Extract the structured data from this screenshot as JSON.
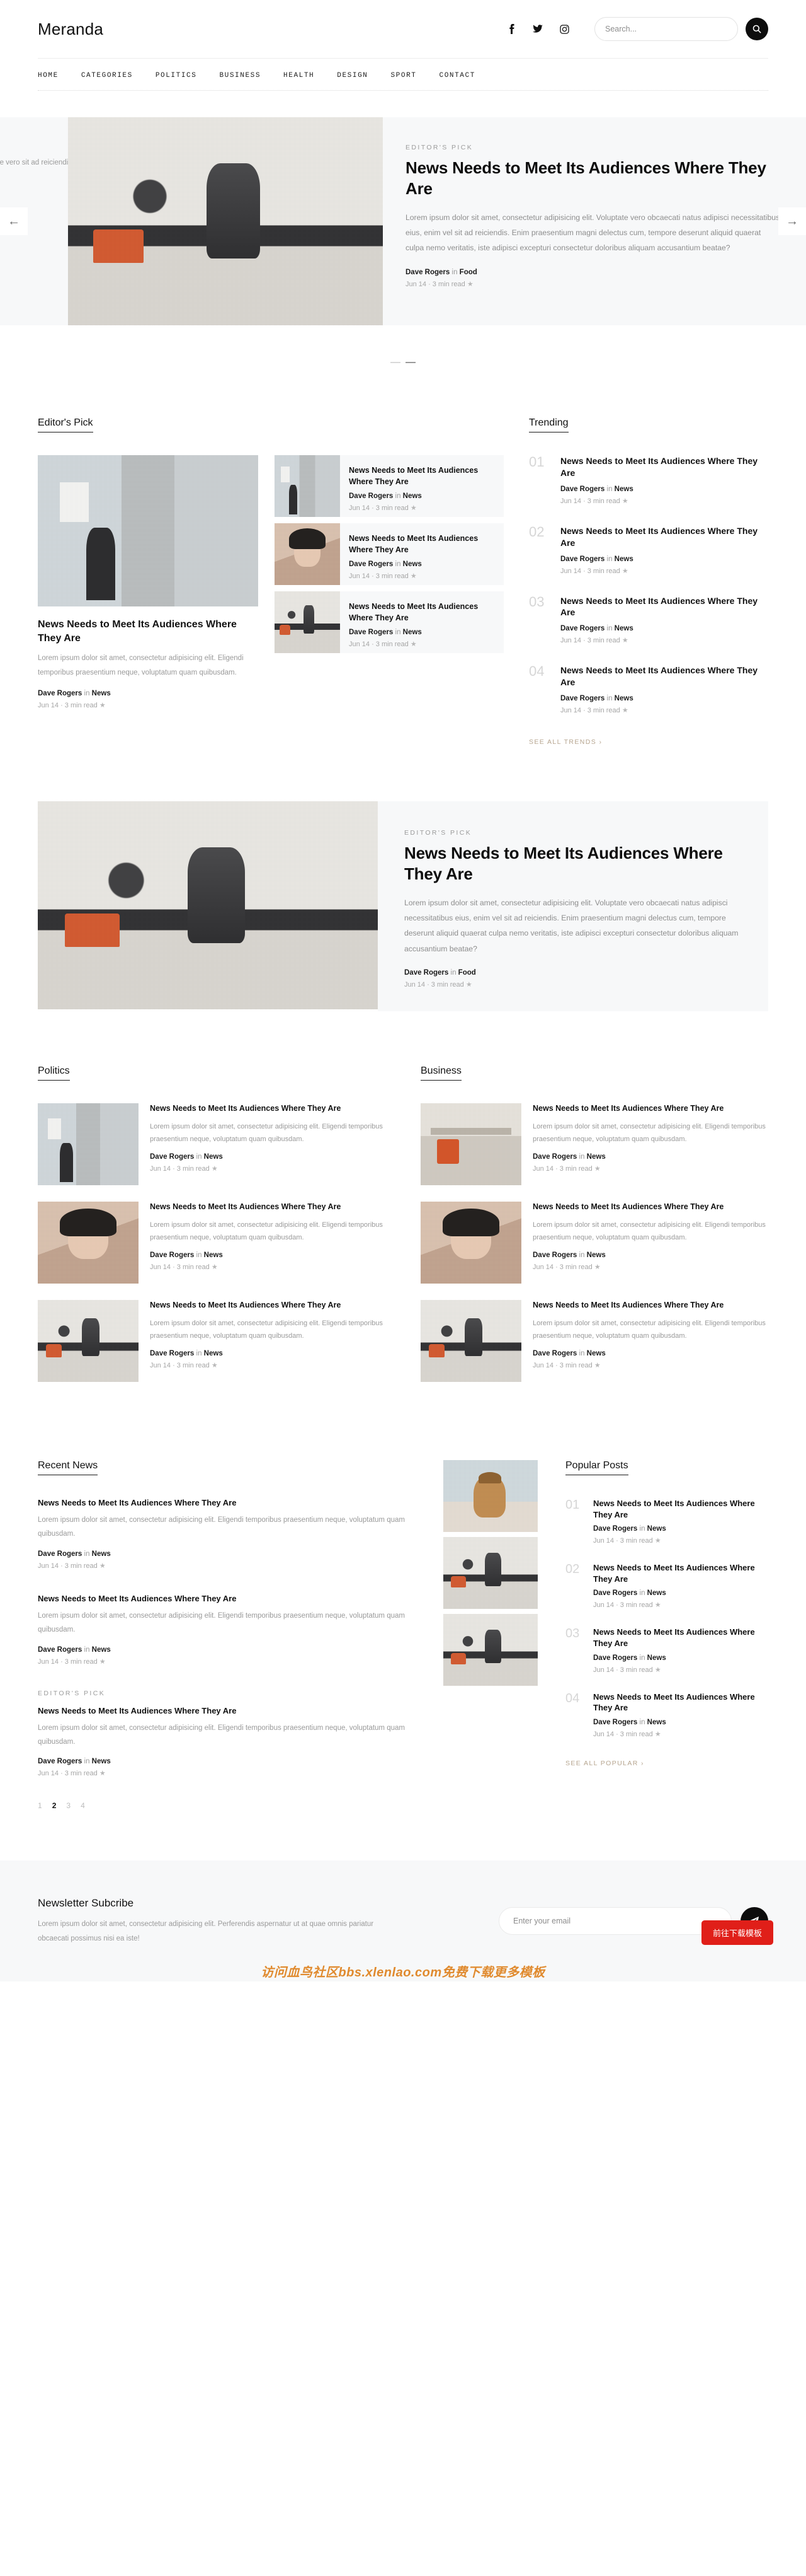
{
  "site": {
    "brand": "Meranda"
  },
  "header": {
    "social": [
      {
        "name": "facebook-icon",
        "label": "f"
      },
      {
        "name": "twitter-icon",
        "label": "t"
      },
      {
        "name": "instagram-icon",
        "label": "i"
      }
    ],
    "search": {
      "placeholder": "Search...",
      "value": "",
      "button_icon": "search-icon"
    }
  },
  "nav": {
    "items": [
      "HOME",
      "CATEGORIES",
      "POLITICS",
      "BUSINESS",
      "HEALTH",
      "DESIGN",
      "SPORT",
      "CONTACT"
    ]
  },
  "hero": {
    "eyebrow": "EDITOR'S PICK",
    "title": "News Needs to Meet Its Audiences Where They Are",
    "desc": "Lorem ipsum dolor sit amet, consectetur adipisicing elit. Voluptate vero obcaecati natus adipisci necessitatibus eius, enim vel sit ad reiciendis. Enim praesentium magni delectus cum, tempore deserunt aliquid quaerat culpa nemo veritatis, iste adipisci excepturi consectetur doloribus aliquam accusantium beatae?",
    "author": "Dave Rogers",
    "in": "in",
    "category": "Food",
    "meta": "Jun 14  ·  3 min read",
    "ghost_text": "Voluptate vero\nsit ad reiciendis enim\nquaerat culpa\naliquam",
    "prev_icon": "arrow-left-icon",
    "next_icon": "arrow-right-icon",
    "dots": [
      {
        "active": false
      },
      {
        "active": true
      }
    ]
  },
  "editors_pick": {
    "heading": "Editor's Pick",
    "feature": {
      "title": "News Needs to Meet Its Audiences Where They Are",
      "excerpt": "Lorem ipsum dolor sit amet, consectetur adipisicing elit. Eligendi temporibus praesentium neque, voluptatum quam quibusdam.",
      "author": "Dave Rogers",
      "in": "in",
      "category": "News",
      "meta": "Jun 14  ·  3 min read"
    },
    "list": [
      {
        "title": "News Needs to Meet Its Audiences Where They Are",
        "author": "Dave Rogers",
        "in": "in",
        "category": "News",
        "meta": "Jun 14  ·  3 min read"
      },
      {
        "title": "News Needs to Meet Its Audiences Where They Are",
        "author": "Dave Rogers",
        "in": "in",
        "category": "News",
        "meta": "Jun 14  ·  3 min read"
      },
      {
        "title": "News Needs to Meet Its Audiences Where They Are",
        "author": "Dave Rogers",
        "in": "in",
        "category": "News",
        "meta": "Jun 14  ·  3 min read"
      }
    ]
  },
  "trending": {
    "heading": "Trending",
    "see_all": "SEE ALL TRENDS  ›",
    "items": [
      {
        "num": "01",
        "title": "News Needs to Meet Its Audiences Where They Are",
        "author": "Dave Rogers",
        "in": "in",
        "category": "News",
        "meta": "Jun 14  ·  3 min read"
      },
      {
        "num": "02",
        "title": "News Needs to Meet Its Audiences Where They Are",
        "author": "Dave Rogers",
        "in": "in",
        "category": "News",
        "meta": "Jun 14  ·  3 min read"
      },
      {
        "num": "03",
        "title": "News Needs to Meet Its Audiences Where They Are",
        "author": "Dave Rogers",
        "in": "in",
        "category": "News",
        "meta": "Jun 14  ·  3 min read"
      },
      {
        "num": "04",
        "title": "News Needs to Meet Its Audiences Where They Are",
        "author": "Dave Rogers",
        "in": "in",
        "category": "News",
        "meta": "Jun 14  ·  3 min read"
      }
    ]
  },
  "banner": {
    "eyebrow": "EDITOR'S PICK",
    "title": "News Needs to Meet Its Audiences Where They Are",
    "desc": "Lorem ipsum dolor sit amet, consectetur adipisicing elit. Voluptate vero obcaecati natus adipisci necessitatibus eius, enim vel sit ad reiciendis. Enim praesentium magni delectus cum, tempore deserunt aliquid quaerat culpa nemo veritatis, iste adipisci excepturi consectetur doloribus aliquam accusantium beatae?",
    "author": "Dave Rogers",
    "in": "in",
    "category": "Food",
    "meta": "Jun 14  ·  3 min read"
  },
  "categories": [
    {
      "heading": "Politics",
      "items": [
        {
          "title": "News Needs to Meet Its Audiences Where They Are",
          "excerpt": "Lorem ipsum dolor sit amet, consectetur adipisicing elit. Eligendi temporibus praesentium neque, voluptatum quam quibusdam.",
          "author": "Dave Rogers",
          "in": "in",
          "category": "News",
          "meta": "Jun 14  ·  3 min read",
          "art": "ph-gallery"
        },
        {
          "title": "News Needs to Meet Its Audiences Where They Are",
          "excerpt": "Lorem ipsum dolor sit amet, consectetur adipisicing elit. Eligendi temporibus praesentium neque, voluptatum quam quibusdam.",
          "author": "Dave Rogers",
          "in": "in",
          "category": "News",
          "meta": "Jun 14  ·  3 min read",
          "art": "ph-portrait"
        },
        {
          "title": "News Needs to Meet Its Audiences Where They Are",
          "excerpt": "Lorem ipsum dolor sit amet, consectetur adipisicing elit. Eligendi temporibus praesentium neque, voluptatum quam quibusdam.",
          "author": "Dave Rogers",
          "in": "in",
          "category": "News",
          "meta": "Jun 14  ·  3 min read",
          "art": "ph-kitchen"
        }
      ]
    },
    {
      "heading": "Business",
      "items": [
        {
          "title": "News Needs to Meet Its Audiences Where They Are",
          "excerpt": "Lorem ipsum dolor sit amet, consectetur adipisicing elit. Eligendi temporibus praesentium neque, voluptatum quam quibusdam.",
          "author": "Dave Rogers",
          "in": "in",
          "category": "News",
          "meta": "Jun 14  ·  3 min read",
          "art": "ph-shelf"
        },
        {
          "title": "News Needs to Meet Its Audiences Where They Are",
          "excerpt": "Lorem ipsum dolor sit amet, consectetur adipisicing elit. Eligendi temporibus praesentium neque, voluptatum quam quibusdam.",
          "author": "Dave Rogers",
          "in": "in",
          "category": "News",
          "meta": "Jun 14  ·  3 min read",
          "art": "ph-portrait"
        },
        {
          "title": "News Needs to Meet Its Audiences Where They Are",
          "excerpt": "Lorem ipsum dolor sit amet, consectetur adipisicing elit. Eligendi temporibus praesentium neque, voluptatum quam quibusdam.",
          "author": "Dave Rogers",
          "in": "in",
          "category": "News",
          "meta": "Jun 14  ·  3 min read",
          "art": "ph-kitchen"
        }
      ]
    }
  ],
  "recent": {
    "heading": "Recent News",
    "items": [
      {
        "eyebrow": "",
        "title": "News Needs to Meet Its Audiences Where They Are",
        "excerpt": "Lorem ipsum dolor sit amet, consectetur adipisicing elit. Eligendi temporibus praesentium neque, voluptatum quam quibusdam.",
        "author": "Dave Rogers",
        "in": "in",
        "category": "News",
        "meta": "Jun 14  ·  3 min read"
      },
      {
        "eyebrow": "",
        "title": "News Needs to Meet Its Audiences Where They Are",
        "excerpt": "Lorem ipsum dolor sit amet, consectetur adipisicing elit. Eligendi temporibus praesentium neque, voluptatum quam quibusdam.",
        "author": "Dave Rogers",
        "in": "in",
        "category": "News",
        "meta": "Jun 14  ·  3 min read"
      },
      {
        "eyebrow": "EDITOR'S PICK",
        "title": "News Needs to Meet Its Audiences Where They Are",
        "excerpt": "Lorem ipsum dolor sit amet, consectetur adipisicing elit. Eligendi temporibus praesentium neque, voluptatum quam quibusdam.",
        "author": "Dave Rogers",
        "in": "in",
        "category": "News",
        "meta": "Jun 14  ·  3 min read"
      }
    ],
    "pagination": {
      "pages": [
        "1",
        "2",
        "3",
        "4"
      ],
      "active": "2"
    }
  },
  "popular": {
    "heading": "Popular Posts",
    "see_all": "SEE ALL POPULAR  ›",
    "items": [
      {
        "num": "01",
        "title": "News Needs to Meet Its Audiences Where They Are",
        "author": "Dave Rogers",
        "in": "in",
        "category": "News",
        "meta": "Jun 14  ·  3 min read"
      },
      {
        "num": "02",
        "title": "News Needs to Meet Its Audiences Where They Are",
        "author": "Dave Rogers",
        "in": "in",
        "category": "News",
        "meta": "Jun 14  ·  3 min read"
      },
      {
        "num": "03",
        "title": "News Needs to Meet Its Audiences Where They Are",
        "author": "Dave Rogers",
        "in": "in",
        "category": "News",
        "meta": "Jun 14  ·  3 min read"
      },
      {
        "num": "04",
        "title": "News Needs to Meet Its Audiences Where They Are",
        "author": "Dave Rogers",
        "in": "in",
        "category": "News",
        "meta": "Jun 14  ·  3 min read"
      }
    ]
  },
  "newsletter": {
    "heading": "Newsletter Subcribe",
    "desc": "Lorem ipsum dolor sit amet, consectetur adipisicing elit. Perferendis aspernatur ut at quae omnis pariatur obcaecati possimus nisi ea iste!",
    "placeholder": "Enter your email",
    "value": "",
    "send_icon": "paper-plane-icon"
  },
  "overlay": {
    "download_button": "前往下载模板",
    "download_button_color": "#e01f19",
    "watermark": "访问血鸟社区bbs.xlenlao.com免费下载更多模板",
    "watermark_color": "#e08a2e"
  }
}
